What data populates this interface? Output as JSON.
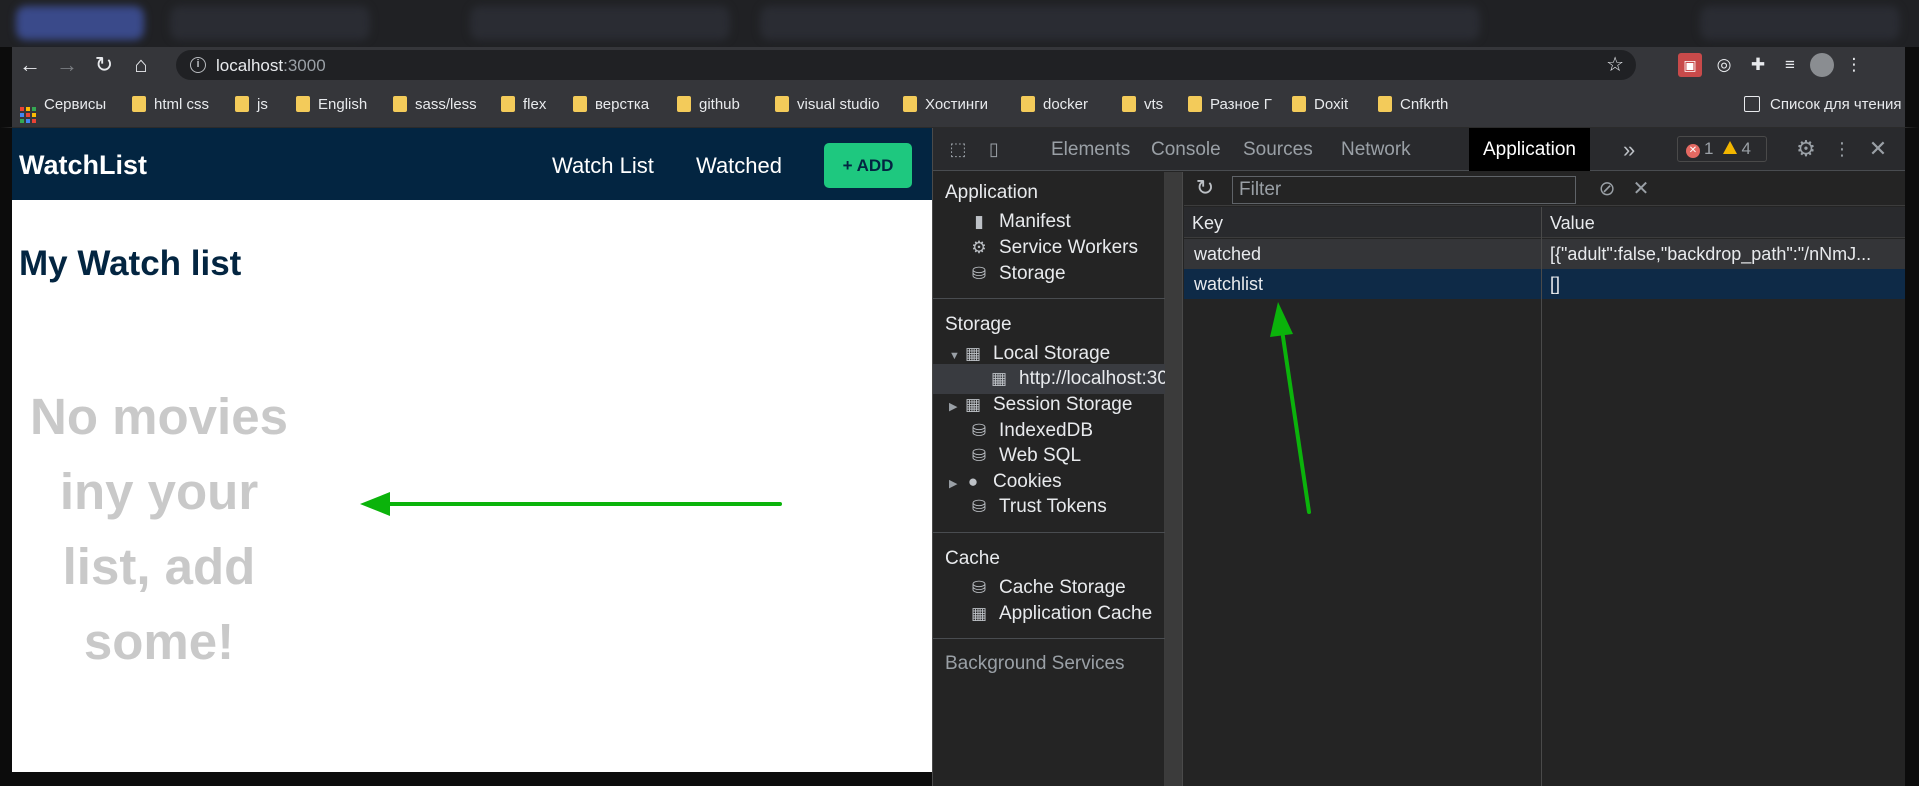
{
  "browser": {
    "url_host": "localhost",
    "url_port": ":3000",
    "bookmarks": [
      "Сервисы",
      "html css",
      "js",
      "English",
      "sass/less",
      "flex",
      "верстка",
      "github",
      "visual studio",
      "Хостинги",
      "docker",
      "vts",
      "Разное Г",
      "Doxit",
      "Cnfkrth"
    ],
    "reading_list": "Список для чтения"
  },
  "app": {
    "brand": "WatchList",
    "nav": {
      "watch_list": "Watch List",
      "watched": "Watched",
      "add": "+ ADD"
    },
    "heading": "My Watch list",
    "empty_message": "No movies iny your list, add some!"
  },
  "devtools": {
    "tabs": [
      "Elements",
      "Console",
      "Sources",
      "Network",
      "Application"
    ],
    "active_tab": "Application",
    "more_tabs": "»",
    "errors": "1",
    "warnings": "4",
    "sidebar": {
      "application_header": "Application",
      "application_items": [
        "Manifest",
        "Service Workers",
        "Storage"
      ],
      "storage_header": "Storage",
      "local_storage": "Local Storage",
      "local_storage_origin": "http://localhost:30",
      "session_storage": "Session Storage",
      "indexeddb": "IndexedDB",
      "websql": "Web SQL",
      "cookies": "Cookies",
      "trust_tokens": "Trust Tokens",
      "cache_header": "Cache",
      "cache_storage": "Cache Storage",
      "application_cache": "Application Cache",
      "background_header": "Background Services"
    },
    "filter_placeholder": "Filter",
    "columns": {
      "key": "Key",
      "value": "Value"
    },
    "entries": [
      {
        "key": "watched",
        "value": "[{\"adult\":false,\"backdrop_path\":\"/nNmJ..."
      },
      {
        "key": "watchlist",
        "value": "[]"
      }
    ]
  },
  "colors": {
    "header_bg": "#032541",
    "add_button": "#1ec87f",
    "annotation_arrow": "#0bb30b",
    "selected_row": "#0e2a47"
  }
}
